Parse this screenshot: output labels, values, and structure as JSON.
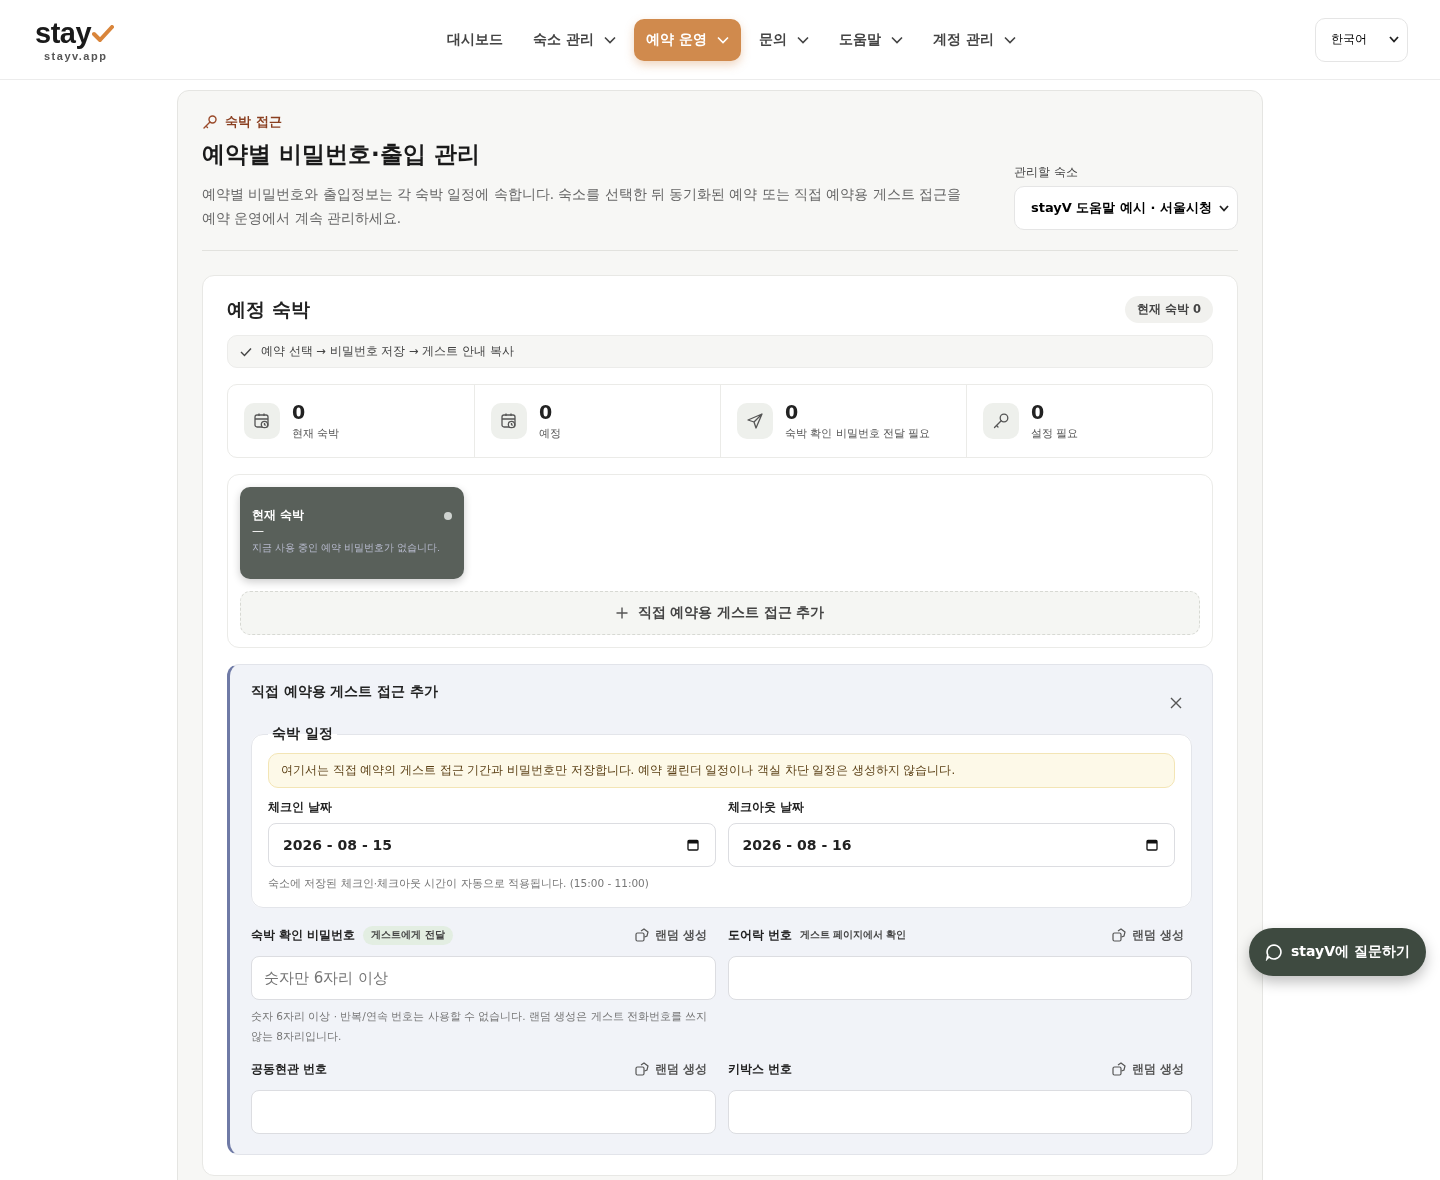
{
  "brand": {
    "name": "stay",
    "domain": "stayv.app"
  },
  "nav": [
    {
      "label": "대시보드",
      "kind": "link",
      "selected": false
    },
    {
      "label": "숙소 관리",
      "kind": "dropdown",
      "selected": false
    },
    {
      "label": "예약 운영",
      "kind": "dropdown",
      "selected": true
    },
    {
      "label": "문의",
      "kind": "dropdown",
      "selected": false
    },
    {
      "label": "도움말",
      "kind": "dropdown",
      "selected": false
    },
    {
      "label": "계정 관리",
      "kind": "dropdown",
      "selected": false
    }
  ],
  "language": "한국어",
  "header": {
    "eyebrow": "숙박 접근",
    "title": "예약별 비밀번호·출입 관리",
    "description": "예약별 비밀번호와 출입정보는 각 숙박 일정에 속합니다. 숙소를 선택한 뒤 동기화된 예약 또는 직접 예약용 게스트 접근을 예약 운영에서 계속 관리하세요.",
    "property_label": "관리할 숙소",
    "property_value": "stayV 도움말 예시 · 서울시청"
  },
  "upcoming": {
    "title": "예정 숙박",
    "badge": "현재 숙박 0",
    "steps": "예약 선택 → 비밀번호 저장 → 게스트 안내 복사",
    "stats": [
      {
        "value": "0",
        "label": "현재 숙박"
      },
      {
        "value": "0",
        "label": "예정"
      },
      {
        "value": "0",
        "label": "숙박 확인 비밀번호 전달 필요"
      },
      {
        "value": "0",
        "label": "설정 필요"
      }
    ],
    "stay_card": {
      "title": "현재 숙박",
      "dash": "—",
      "note": "지금 사용 중인 예약 비밀번호가 없습니다."
    },
    "add_button": "직접 예약용 게스트 접근 추가"
  },
  "form": {
    "title": "직접 예약용 게스트 접근 추가",
    "schedule_legend": "숙박 일정",
    "notice": "여기서는 직접 예약의 게스트 접근 기간과 비밀번호만 저장합니다. 예약 캘린더 일정이나 객실 차단 일정은 생성하지 않습니다.",
    "dates": [
      {
        "label": "체크인 날짜",
        "value": "2026 - 08 - 15"
      },
      {
        "label": "체크아웃 날짜",
        "value": "2026 - 08 - 16"
      }
    ],
    "date_hint": "숙소에 저장된 체크인·체크아웃 시간이 자동으로 적용됩니다. (15:00 - 11:00)",
    "fields": [
      {
        "label": "숙박 확인 비밀번호",
        "tag": "게스트에게 전달",
        "action": "랜덤 생성",
        "placeholder": "숫자만 6자리 이상",
        "hint": "숫자 6자리 이상 · 반복/연속 번호는 사용할 수 없습니다. 랜덤 생성은 게스트 전화번호를 쓰지 않는 8자리입니다."
      },
      {
        "label": "도어락 번호",
        "tag": "게스트 페이지에서 확인",
        "action": "랜덤 생성"
      },
      {
        "label": "공동현관 번호",
        "action": "랜덤 생성"
      },
      {
        "label": "키박스 번호",
        "action": "랜덤 생성"
      }
    ]
  },
  "chat_button": "stayV에 질문하기"
}
